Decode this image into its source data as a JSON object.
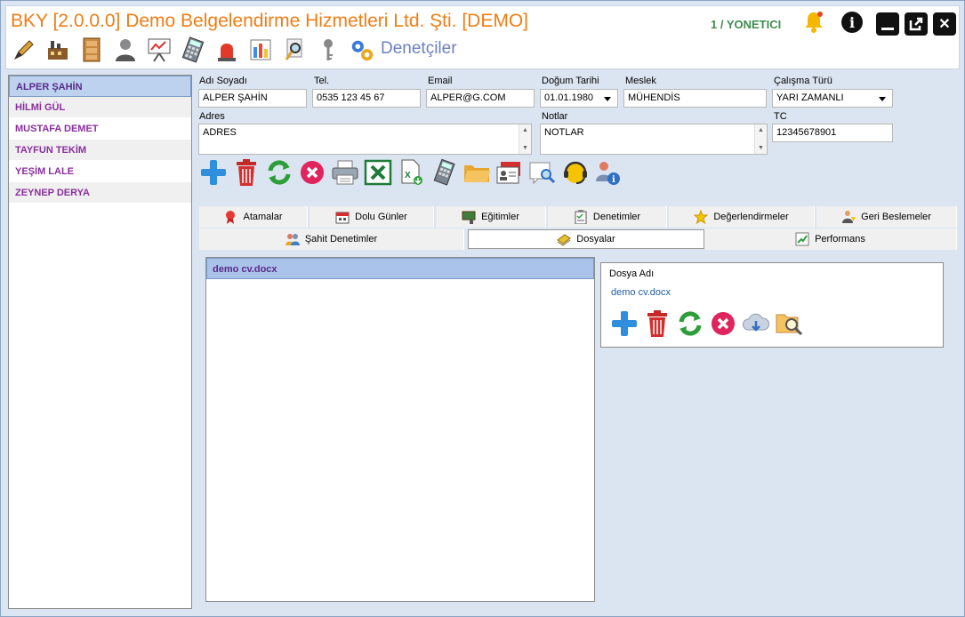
{
  "window": {
    "title": "BKY [2.0.0.0] Demo Belgelendirme Hizmetleri Ltd. Şti. [DEMO]",
    "user": "1 / YONETICI",
    "section_title": "Denetçiler"
  },
  "toolbar_icons": [
    "pen-icon",
    "factory-icon",
    "cabinet-icon",
    "person-icon",
    "presentation-icon",
    "calculator-icon",
    "siren-icon",
    "bar-chart-icon",
    "magnifier-icon",
    "key-icon",
    "gears-icon"
  ],
  "sidebar": {
    "items": [
      {
        "label": "ALPER ŞAHİN",
        "selected": true
      },
      {
        "label": "HİLMİ GÜL",
        "selected": false
      },
      {
        "label": "MUSTAFA DEMET",
        "selected": false
      },
      {
        "label": "TAYFUN TEKİM",
        "selected": false
      },
      {
        "label": "YEŞİM LALE",
        "selected": false
      },
      {
        "label": "ZEYNEP DERYA",
        "selected": false
      }
    ]
  },
  "form": {
    "name_label": "Adı Soyadı",
    "name_value": "ALPER ŞAHİN",
    "tel_label": "Tel.",
    "tel_value": "0535 123 45 67",
    "email_label": "Email",
    "email_value": "ALPER@G.COM",
    "birth_label": "Doğum Tarihi",
    "birth_value": "01.01.1980",
    "job_label": "Meslek",
    "job_value": "MÜHENDİS",
    "worktype_label": "Çalışma Türü",
    "worktype_value": "YARI ZAMANLI",
    "address_label": "Adres",
    "address_value": "ADRES",
    "notes_label": "Notlar",
    "notes_value": "NOTLAR",
    "tc_label": "TC",
    "tc_value": "12345678901"
  },
  "tabs": {
    "atamalar": "Atamalar",
    "dolu_gunler": "Dolu Günler",
    "egitimler": "Eğitimler",
    "denetimler": "Denetimler",
    "degerlendirmeler": "Değerlendirmeler",
    "geri_beslemeler": "Geri Beslemeler",
    "sahit_denetimler": "Şahit Denetimler",
    "dosyalar": "Dosyalar",
    "performans": "Performans",
    "active": "Dosyalar"
  },
  "files": {
    "rows": [
      "demo cv.docx"
    ]
  },
  "dosya_panel": {
    "label": "Dosya Adı",
    "value": "demo cv.docx"
  },
  "colors": {
    "title": "#f07d16",
    "user": "#3f8c4f",
    "section": "#6b7fc4",
    "sidebar_text": "#8a2f9e",
    "selection": "#bcd2ee"
  }
}
